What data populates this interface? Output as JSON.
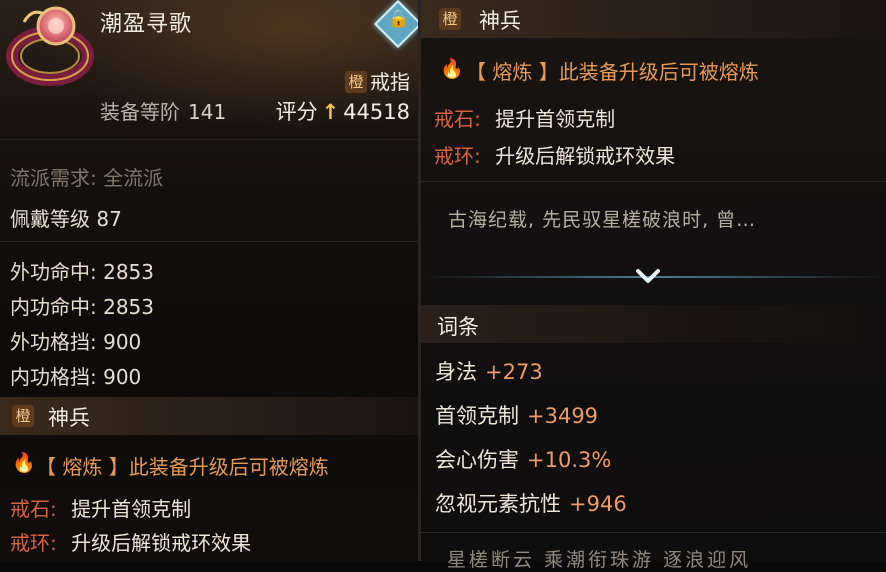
{
  "left_panel": {
    "item_name": "潮盈寻歌",
    "grade_badge": "橙",
    "item_type": "戒指",
    "tier_label": "装备等阶",
    "tier_value": "141",
    "score_label": "评分",
    "score_arrow": "↑",
    "score_value": "44518",
    "lock_icon": "lock-icon",
    "lock_glyph": "🔒",
    "school_requirement": "流派需求: 全流派",
    "wear_level": "佩戴等级 87",
    "stats": [
      "外功命中: 2853",
      "内功命中: 2853",
      "外功格挡: 900",
      "内功格挡: 900"
    ],
    "section_title": "神兵",
    "flame_glyph": "🔥",
    "refine_text": "【 熔炼 】此装备升级后可被熔炼",
    "ring_stone_key": "戒石:",
    "ring_stone_val": "提升首领克制",
    "ring_band_key": "戒环:",
    "ring_band_val": "升级后解锁戒环效果"
  },
  "right_panel": {
    "section_title": "神兵",
    "grade_badge": "橙",
    "flame_glyph": "🔥",
    "refine_text": "【 熔炼 】此装备升级后可被熔炼",
    "ring_stone_key": "戒石:",
    "ring_stone_val": "提升首领克制",
    "ring_band_key": "戒环:",
    "ring_band_val": "升级后解锁戒环效果",
    "lore_text": "古海纪载, 先民驭星槎破浪时, 曾…",
    "affix_title": "词条",
    "affixes": [
      {
        "name": "身法",
        "value": "+273"
      },
      {
        "name": "首领克制",
        "value": "+3499"
      },
      {
        "name": "会心伤害",
        "value": "+10.3%"
      },
      {
        "name": "忽视元素抗性",
        "value": "+946"
      }
    ],
    "bottom_text": "星槎断云 乘潮衔珠游 逐浪迎风"
  },
  "colors": {
    "accent_orange": "#f08a2c",
    "key_red": "#d9623c",
    "stat_value": "#ef9a6a",
    "score_arrow": "#f1c44a",
    "lock_blue": "#5fa7c2"
  }
}
